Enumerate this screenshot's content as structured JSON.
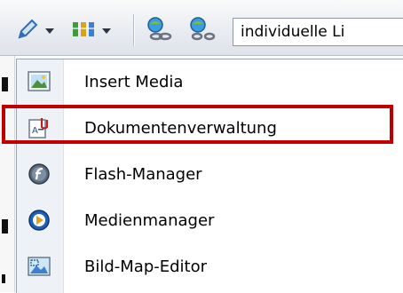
{
  "toolbar": {
    "input_value": "individuelle Li",
    "icons": [
      "pencil-icon",
      "columns-icon",
      "link-icon",
      "unlink-icon"
    ]
  },
  "menu": {
    "items": [
      {
        "label": "Insert Media",
        "icon": "image-icon"
      },
      {
        "label": "Dokumentenverwaltung",
        "icon": "document-manager-icon",
        "highlighted": true
      },
      {
        "label": "Flash-Manager",
        "icon": "flash-icon"
      },
      {
        "label": "Medienmanager",
        "icon": "media-player-icon"
      },
      {
        "label": "Bild-Map-Editor",
        "icon": "image-map-icon"
      }
    ]
  },
  "colors": {
    "highlight": "#c00000",
    "menu_gutter": "#eef1f6"
  }
}
